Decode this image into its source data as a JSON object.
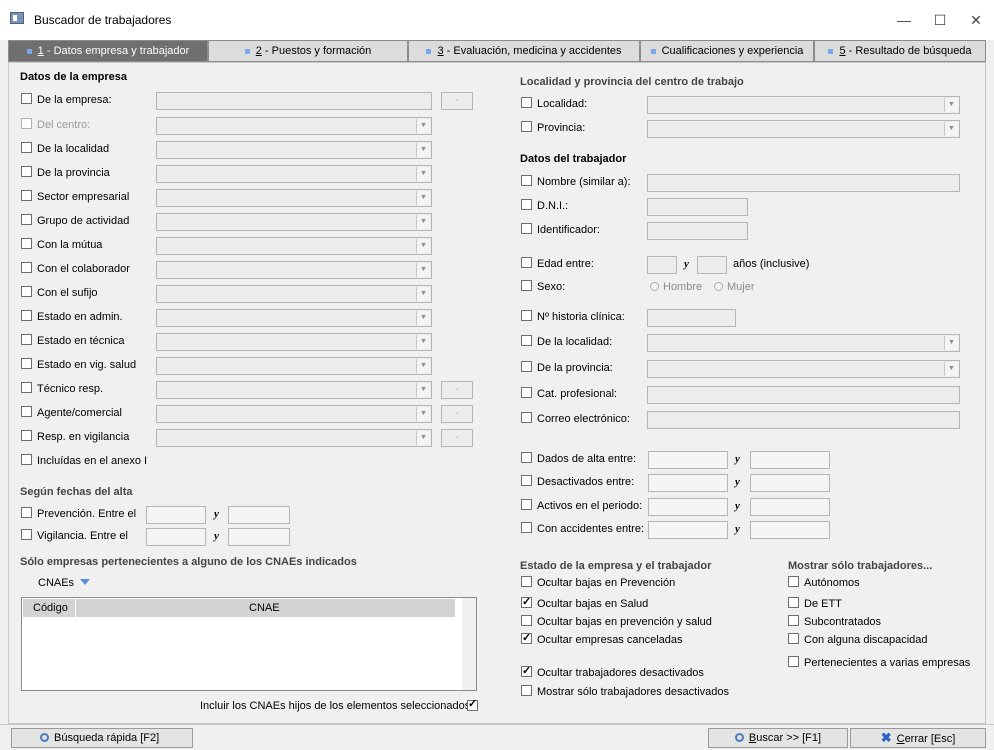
{
  "window": {
    "title": "Buscador de trabajadores",
    "minimize": "—",
    "maximize": "☐",
    "close": "✕"
  },
  "tabs": [
    {
      "num": "1",
      "label": " - Datos empresa y trabajador"
    },
    {
      "num": "2",
      "label": " - Puestos y formación"
    },
    {
      "num": "3",
      "label": " - Evaluación, medicina y accidentes"
    },
    {
      "num": "",
      "label": "Cualificaciones y experiencia"
    },
    {
      "num": "5",
      "label": " - Resultado de búsqueda"
    }
  ],
  "empresa": {
    "title": "Datos de la empresa",
    "rows": [
      {
        "label": "De la empresa:"
      },
      {
        "label": "Del centro:"
      },
      {
        "label": "De la localidad"
      },
      {
        "label": "De la provincia"
      },
      {
        "label": "Sector empresarial"
      },
      {
        "label": "Grupo de actividad"
      },
      {
        "label": "Con la mútua"
      },
      {
        "label": "Con el colaborador"
      },
      {
        "label": "Con el sufijo"
      },
      {
        "label": "Estado en admin."
      },
      {
        "label": "Estado en técnica"
      },
      {
        "label": "Estado en vig. salud"
      },
      {
        "label": "Técnico resp."
      },
      {
        "label": "Agente/comercial"
      },
      {
        "label": "Resp. en vigilancia"
      },
      {
        "label": "Incluídas en el anexo I"
      }
    ]
  },
  "fechas": {
    "title": "Según fechas del alta",
    "prevencion": "Prevención. Entre el",
    "vigilancia": "Vigilancia. Entre el",
    "y": "y"
  },
  "cnae": {
    "title": "Sólo empresas pertenecientes a alguno de los CNAEs indicados",
    "dropdown": "CNAEs",
    "col_codigo": "Código",
    "col_cnae": "CNAE",
    "include_children": "Incluir los CNAEs hijos de los elementos seleccionados",
    "include_checked": true
  },
  "localidad": {
    "title": "Localidad y provincia del centro de trabajo",
    "localidad": "Localidad:",
    "provincia": "Provincia:"
  },
  "trabajador": {
    "title": "Datos del trabajador",
    "nombre": "Nombre (similar a):",
    "dni": "D.N.I.:",
    "identificador": "Identificador:",
    "edad": "Edad entre:",
    "y": "y",
    "anios": "años (inclusive)",
    "sexo": "Sexo:",
    "hombre": "Hombre",
    "mujer": "Mujer",
    "historia": "Nº historia clínica:",
    "localidad": "De la localidad:",
    "provincia": "De la provincia:",
    "cat": "Cat. profesional:",
    "correo": "Correo electrónico:",
    "alta": "Dados de alta entre:",
    "desactivados": "Desactivados entre:",
    "activos": "Activos en el periodo:",
    "accidentes": "Con accidentes entre:"
  },
  "estado": {
    "title": "Estado de la empresa y el trabajador",
    "items": [
      {
        "label": "Ocultar bajas en Prevención",
        "checked": false
      },
      {
        "label": "Ocultar bajas en Salud",
        "checked": true
      },
      {
        "label": "Ocultar bajas en prevención y salud",
        "checked": false
      },
      {
        "label": "Ocultar empresas canceladas",
        "checked": true
      },
      {
        "label": "Ocultar trabajadores desactivados",
        "checked": true
      },
      {
        "label": "Mostrar sólo trabajadores desactivados",
        "checked": false
      }
    ]
  },
  "mostrar": {
    "title": "Mostrar sólo trabajadores...",
    "items": [
      {
        "label": "Autónomos"
      },
      {
        "label": "De ETT"
      },
      {
        "label": "Subcontratados"
      },
      {
        "label": "Con alguna discapacidad"
      },
      {
        "label": "Pertenecientes a varias empresas"
      }
    ]
  },
  "footer": {
    "quick": "Búsqueda rápida  [F2]",
    "search_u": "B",
    "search": "uscar >>  [F1]",
    "close_u": "C",
    "close": "errar  [Esc]"
  }
}
